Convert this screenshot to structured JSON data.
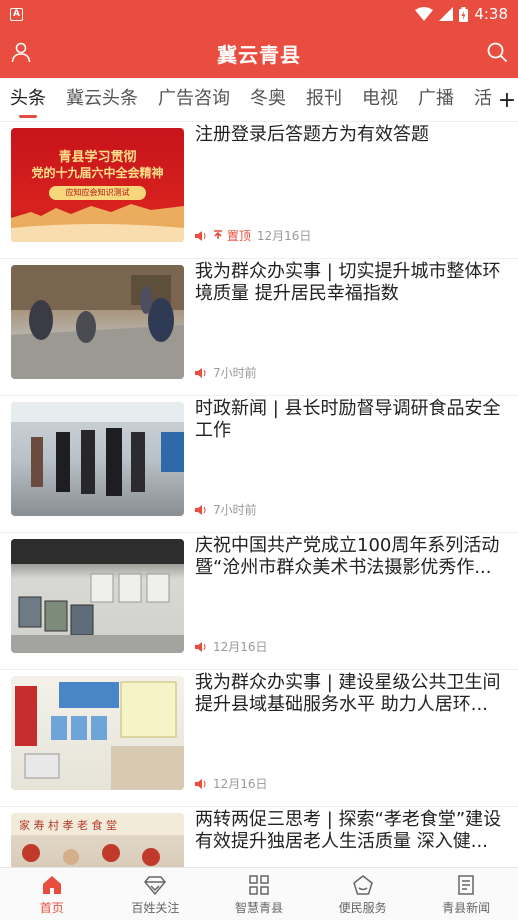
{
  "status_bar": {
    "time": "4:38",
    "app_badge": "A"
  },
  "header": {
    "title": "冀云青县"
  },
  "tabs": [
    "头条",
    "冀云头条",
    "广告咨询",
    "冬奥",
    "报刊",
    "电视",
    "广播",
    "活"
  ],
  "tab_add": "+",
  "articles": [
    {
      "title": "注册登录后答题方为有效答题",
      "pin": "置顶",
      "time": "12月16日",
      "thumb_text": [
        "青县学习贯彻",
        "党的十九届六中全会精神",
        "应知应会知识测试"
      ]
    },
    {
      "title": "我为群众办实事 | 切实提升城市整体环境质量 提升居民幸福指数",
      "time": "7小时前"
    },
    {
      "title": "时政新闻 | 县长时励督导调研食品安全工作",
      "time": "7小时前"
    },
    {
      "title": "庆祝中国共产党成立100周年系列活动暨“沧州市群众美术书法摄影优秀作...",
      "time": "12月16日"
    },
    {
      "title": "我为群众办实事 | 建设星级公共卫生间 提升县域基础服务水平 助力人居环...",
      "time": "12月16日"
    },
    {
      "title": "两转两促三思考 | 探索“孝老食堂”建设 有效提升独居老人生活质量 深入健...",
      "time": ""
    }
  ],
  "bottom_nav": [
    "首页",
    "百姓关注",
    "智慧青县",
    "便民服务",
    "青县新闻"
  ],
  "colors": {
    "accent": "#e94d3f"
  }
}
